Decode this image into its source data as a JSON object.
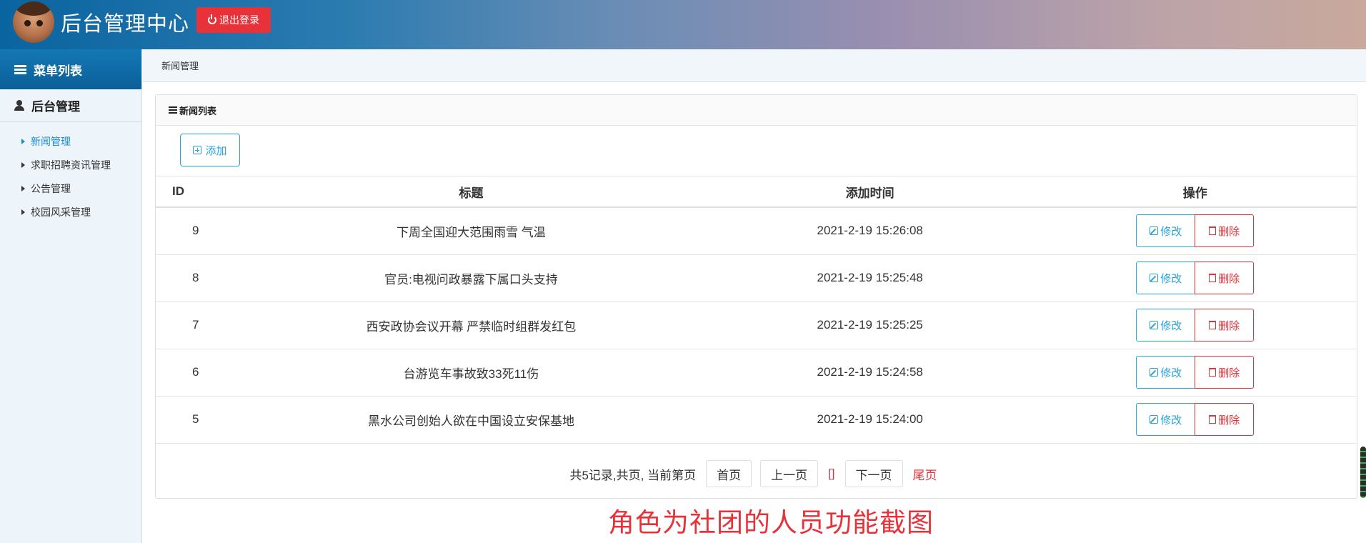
{
  "header": {
    "title": "后台管理中心",
    "logout_label": "退出登录"
  },
  "sidebar": {
    "menu_header": "菜单列表",
    "section_title": "后台管理",
    "items": [
      {
        "label": "新闻管理",
        "active": true
      },
      {
        "label": "求职招聘资讯管理",
        "active": false
      },
      {
        "label": "公告管理",
        "active": false
      },
      {
        "label": "校园风采管理",
        "active": false
      }
    ]
  },
  "breadcrumb": "新闻管理",
  "panel": {
    "title": "新闻列表",
    "add_label": "添加"
  },
  "table": {
    "headers": [
      "ID",
      "标题",
      "添加时间",
      "操作"
    ],
    "rows": [
      {
        "id": "9",
        "title": "下周全国迎大范围雨雪 气温",
        "time": "2021-2-19 15:26:08"
      },
      {
        "id": "8",
        "title": "官员:电视问政暴露下属口头支持",
        "time": "2021-2-19 15:25:48"
      },
      {
        "id": "7",
        "title": "西安政协会议开幕 严禁临时组群发红包",
        "time": "2021-2-19 15:25:25"
      },
      {
        "id": "6",
        "title": "台游览车事故致33死11伤",
        "time": "2021-2-19 15:24:58"
      },
      {
        "id": "5",
        "title": "黑水公司创始人欲在中国设立安保基地",
        "time": "2021-2-19 15:24:00"
      }
    ],
    "edit_label": "修改",
    "delete_label": "删除"
  },
  "pager": {
    "summary": "共5记录,共页, 当前第页",
    "first": "首页",
    "prev": "上一页",
    "current": "[]",
    "next": "下一页",
    "last": "尾页"
  },
  "caption": "角色为社团的人员功能截图",
  "colors": {
    "accent_blue": "#2aa2d6",
    "danger_red": "#e8323a",
    "header_start": "#0a64a0"
  }
}
